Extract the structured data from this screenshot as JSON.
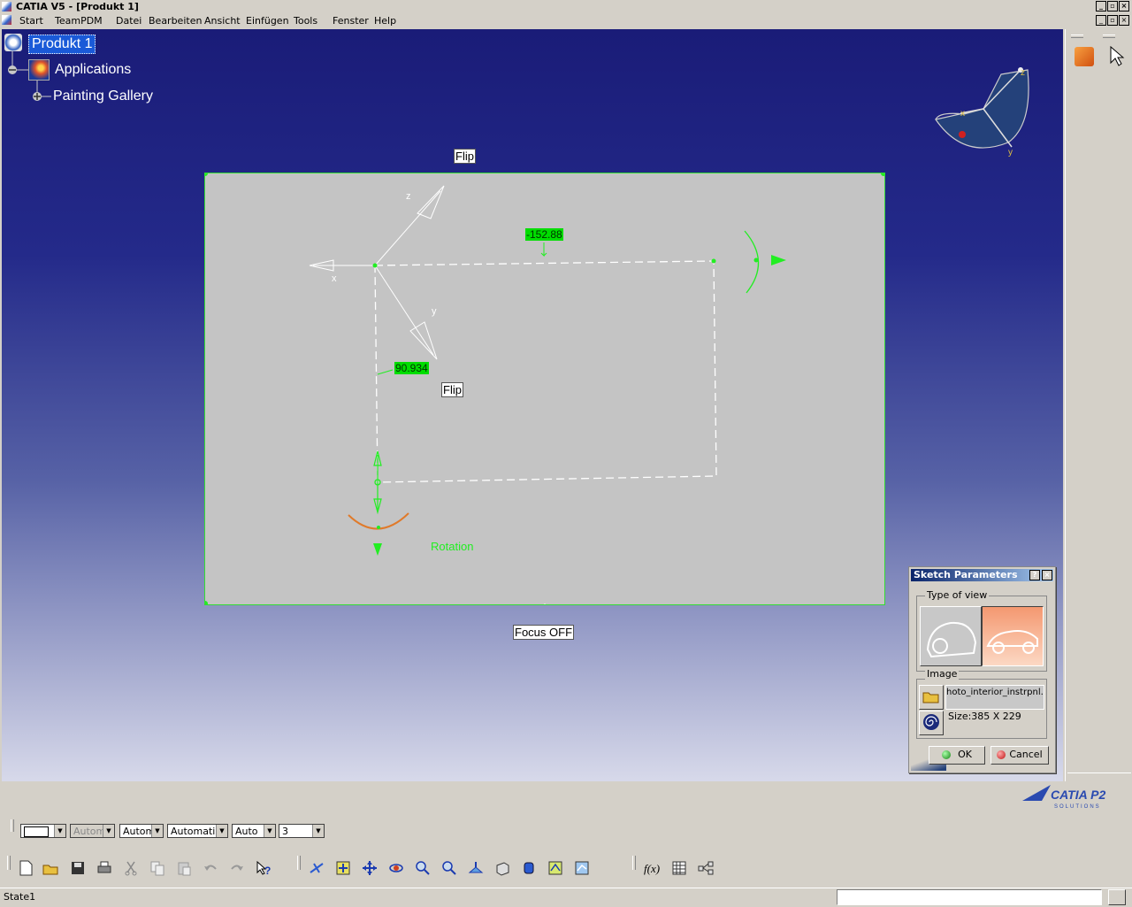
{
  "window": {
    "title": "CATIA V5 - [Produkt 1]"
  },
  "menu": [
    "Start",
    "TeamPDM",
    "Datei",
    "Bearbeiten",
    "Ansicht",
    "Einfügen",
    "Tools",
    "Fenster",
    "Help"
  ],
  "tree": {
    "root": "Produkt 1",
    "children": [
      "Applications",
      "Painting Gallery"
    ]
  },
  "viewport": {
    "flip_top": "Flip",
    "flip_mid": "Flip",
    "dim_horizontal": "152.88",
    "dim_vertical": "90.934",
    "rotation_label": "Rotation",
    "focus_label": "Focus OFF",
    "axis_x": "x",
    "axis_y": "y",
    "axis_z": "z",
    "compass_x": "x",
    "compass_y": "y",
    "compass_z": "z"
  },
  "dialog": {
    "title": "Sketch Parameters",
    "type_of_view_label": "Type of view",
    "image_label": "Image",
    "image_path": "hoto_interior_instrpnl.tif",
    "size_text": "Size:385 X 229",
    "ok_label": "OK",
    "cancel_label": "Cancel"
  },
  "format_toolbar": {
    "color_value": "",
    "transparency_value": "Autom",
    "line_weight_value": "Autom",
    "line_type_value": "Automatisc",
    "point_value": "Auto",
    "layer_value": "3"
  },
  "brand": {
    "logo_text": "CATIA P2",
    "logo_sub": "SOLUTIONS"
  },
  "status": {
    "text": "State1"
  },
  "colors": {
    "viewport_top": "#1a1c78",
    "plane_border": "#33dd33",
    "dimension_bg": "#00dd00",
    "accent_orange": "#e07a2a"
  }
}
